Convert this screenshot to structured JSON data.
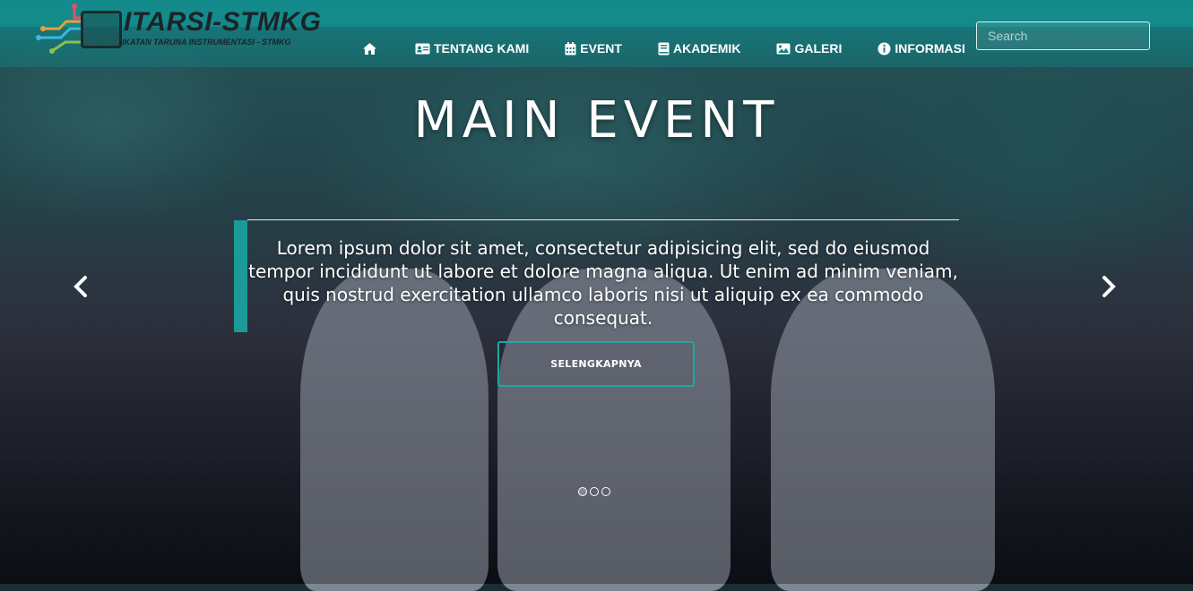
{
  "brand": {
    "name": "ITARSI-STMKG",
    "tagline": "IKATAN TARUNA INSTRUMENTASI - STMKG"
  },
  "nav": {
    "home_icon": "home-icon",
    "items": [
      {
        "label": "TENTANG KAMI",
        "icon": "id-card-icon"
      },
      {
        "label": "EVENT",
        "icon": "calendar-icon"
      },
      {
        "label": "AKADEMIK",
        "icon": "book-icon"
      },
      {
        "label": "GALERI",
        "icon": "image-icon"
      },
      {
        "label": "INFORMASI",
        "icon": "info-circle-icon"
      }
    ]
  },
  "search": {
    "placeholder": "Search",
    "value": ""
  },
  "hero": {
    "title": "MAIN EVENT",
    "caption": "Lorem ipsum dolor sit amet, consectetur adipisicing elit, sed do eiusmod tempor incididunt ut labore et dolore magna aliqua. Ut enim ad minim veniam, quis nostrud exercitation ullamco laboris nisi ut aliquip ex ea commodo consequat.",
    "cta_label": "SELENGKAPNYA",
    "slide_count": 3,
    "active_slide": 1
  },
  "colors": {
    "accent": "#1b9a98",
    "navbar": "#128082"
  }
}
